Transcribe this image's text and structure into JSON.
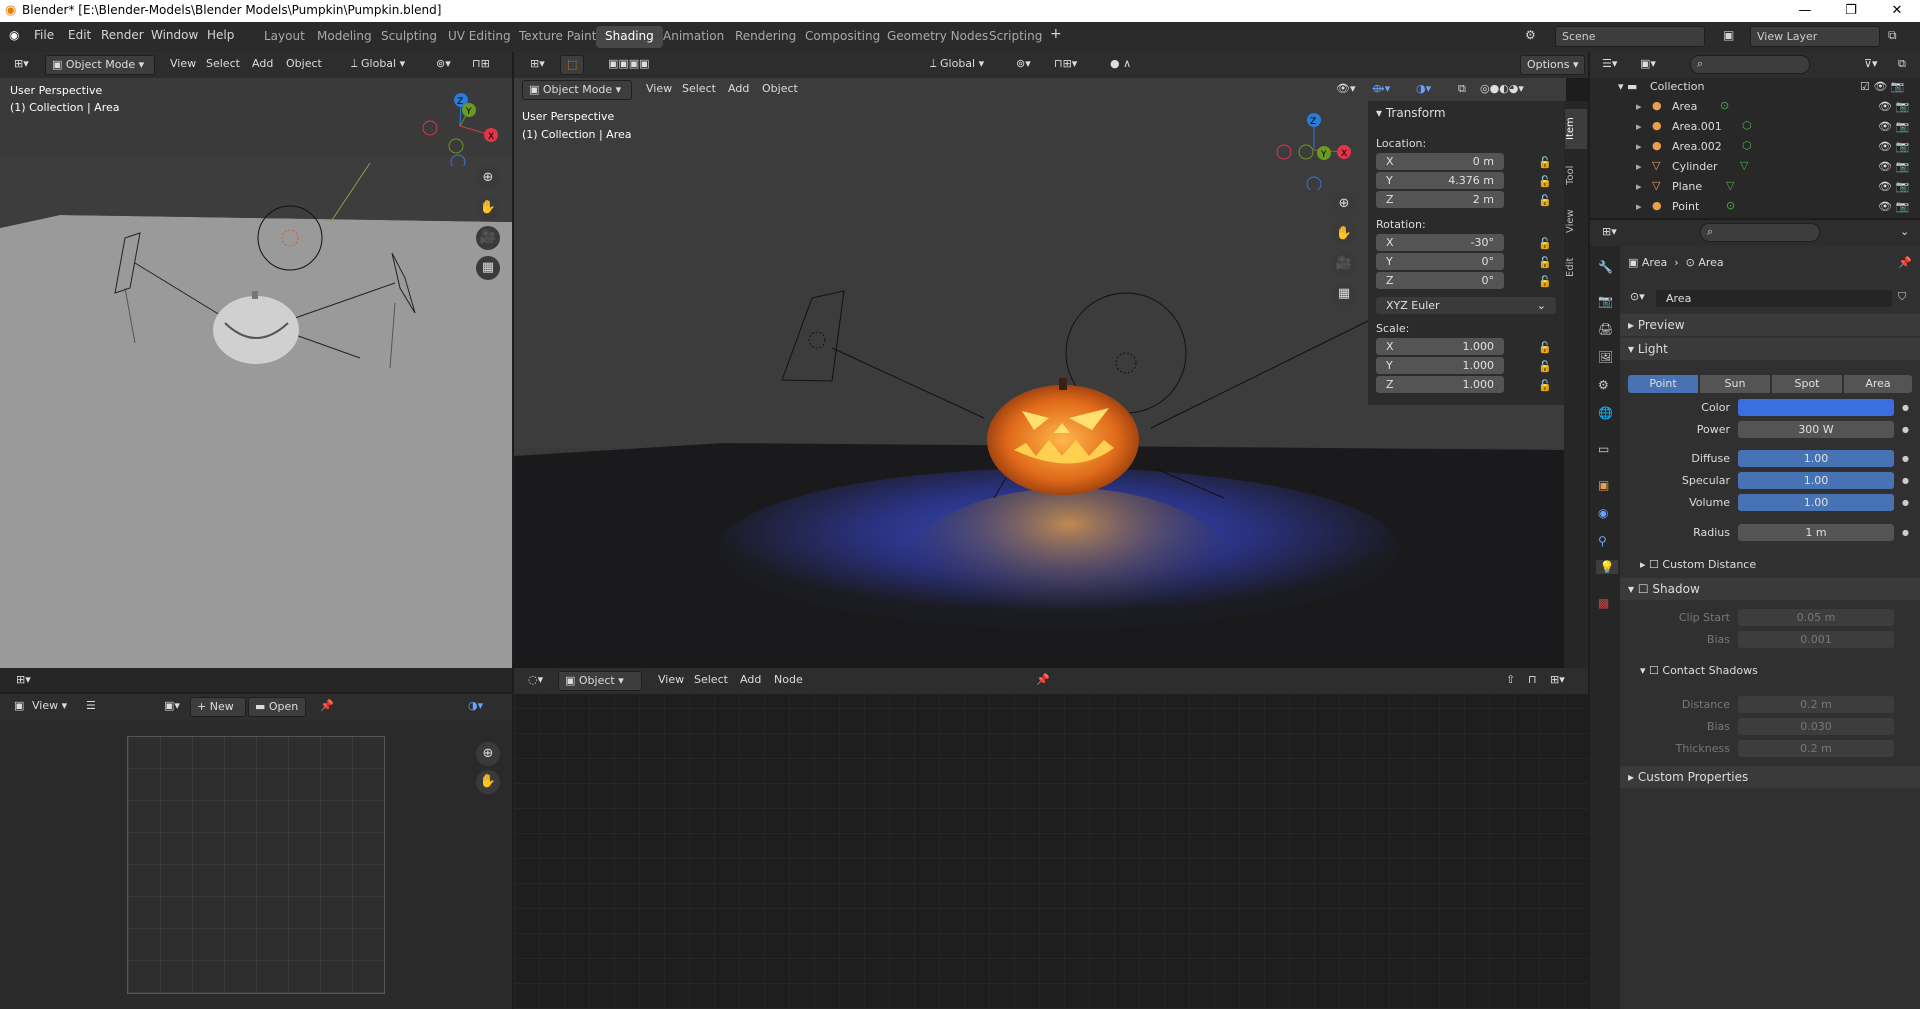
{
  "window": {
    "title": "Blender* [E:\\Blender-Models\\Blender Models\\Pumpkin\\Pumpkin.blend]"
  },
  "menu": [
    "File",
    "Edit",
    "Render",
    "Window",
    "Help"
  ],
  "workspaces": [
    "Layout",
    "Modeling",
    "Sculpting",
    "UV Editing",
    "Texture Paint",
    "Shading",
    "Animation",
    "Rendering",
    "Compositing",
    "Geometry Nodes",
    "Scripting"
  ],
  "active_workspace": "Shading",
  "scene": {
    "name": "Scene",
    "view_layer": "View Layer"
  },
  "left_viewport": {
    "mode": "Object Mode",
    "view": "View",
    "select": "Select",
    "add": "Add",
    "object": "Object",
    "orientation": "Global",
    "overlay_title": "User Perspective",
    "overlay_sub": "(1) Collection | Area"
  },
  "main_viewport": {
    "mode": "Object Mode",
    "view": "View",
    "select": "Select",
    "add": "Add",
    "object": "Object",
    "orientation": "Global",
    "options": "Options",
    "overlay_title": "User Perspective",
    "overlay_sub": "(1) Collection | Area"
  },
  "transform": {
    "title": "Transform",
    "location_label": "Location:",
    "location": [
      {
        "axis": "X",
        "value": "0 m"
      },
      {
        "axis": "Y",
        "value": "4.376 m"
      },
      {
        "axis": "Z",
        "value": "2 m"
      }
    ],
    "rotation_label": "Rotation:",
    "rotation": [
      {
        "axis": "X",
        "value": "-30°"
      },
      {
        "axis": "Y",
        "value": "0°"
      },
      {
        "axis": "Z",
        "value": "0°"
      }
    ],
    "rotation_mode": "XYZ Euler",
    "scale_label": "Scale:",
    "scale": [
      {
        "axis": "X",
        "value": "1.000"
      },
      {
        "axis": "Y",
        "value": "1.000"
      },
      {
        "axis": "Z",
        "value": "1.000"
      }
    ]
  },
  "sidebar_tabs": [
    "Item",
    "Tool",
    "View",
    "Edit"
  ],
  "image_editor": {
    "view": "View",
    "new": "New",
    "open": "Open"
  },
  "node_editor": {
    "object": "Object",
    "view": "View",
    "select": "Select",
    "add": "Add",
    "node": "Node"
  },
  "outliner": {
    "collection": "Collection",
    "items": [
      {
        "name": "Area",
        "color": "#e8a050"
      },
      {
        "name": "Area.001",
        "color": "#e8a050"
      },
      {
        "name": "Area.002",
        "color": "#e8a050"
      },
      {
        "name": "Cylinder",
        "color": "#e8a050"
      },
      {
        "name": "Plane",
        "color": "#e8a050"
      },
      {
        "name": "Point",
        "color": "#e8a050"
      }
    ]
  },
  "properties": {
    "breadcrumb_object": "Area",
    "breadcrumb_data": "Area",
    "data_name": "Area",
    "preview": "Preview",
    "light": "Light",
    "light_types": [
      "Point",
      "Sun",
      "Spot",
      "Area"
    ],
    "active_light_type": "Point",
    "color_label": "Color",
    "color_value": "#3b6fe0",
    "power_label": "Power",
    "power": "300 W",
    "diffuse_label": "Diffuse",
    "diffuse": "1.00",
    "specular_label": "Specular",
    "specular": "1.00",
    "volume_label": "Volume",
    "volume": "1.00",
    "radius_label": "Radius",
    "radius": "1 m",
    "custom_distance": "Custom Distance",
    "shadow": "Shadow",
    "clip_start_label": "Clip Start",
    "clip_start": "0.05 m",
    "bias_label": "Bias",
    "bias": "0.001",
    "contact_shadows": "Contact Shadows",
    "distance_label": "Distance",
    "distance": "0.2 m",
    "cbias_label": "Bias",
    "cbias": "0.030",
    "thickness_label": "Thickness",
    "thickness": "0.2 m",
    "custom_properties": "Custom Properties"
  }
}
